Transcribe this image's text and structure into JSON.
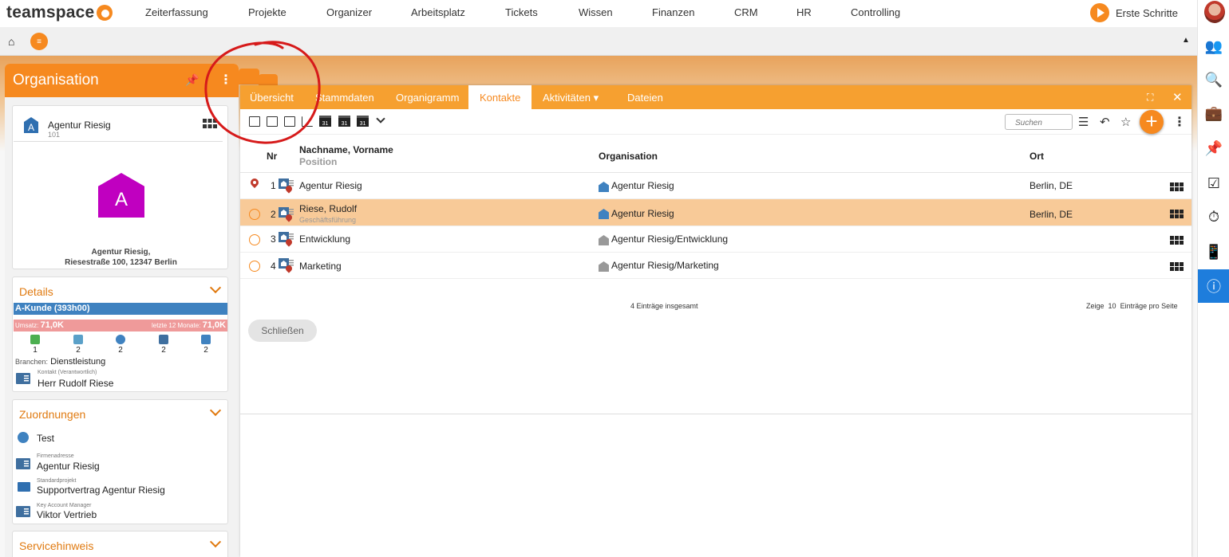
{
  "app": {
    "logo": "teamspace"
  },
  "topnav": {
    "items": [
      "Zeiterfassung",
      "Projekte",
      "Organizer",
      "Arbeitsplatz",
      "Tickets",
      "Wissen",
      "Finanzen",
      "CRM",
      "HR",
      "Controlling"
    ],
    "erste_schritte": "Erste Schritte"
  },
  "colors": {
    "accent": "#f6891f",
    "tab_bar": "#f6a030",
    "selected_row": "#f8ca98",
    "info_blue": "#1e7ddc",
    "akunde": "#3f82c0",
    "umsatz": "#ef9a9a",
    "org_magenta": "#c000c0",
    "annotation": "#d61a1a"
  },
  "left_panel": {
    "title": "Organisation",
    "org": {
      "icon_letter": "A",
      "name": "Agentur Riesig",
      "number": "101",
      "address_line1": "Agentur Riesig,",
      "address_line2": "Riesestraße 100, 12347 Berlin"
    },
    "details": {
      "title": "Details",
      "category": "A-Kunde (393h00)",
      "umsatz_label": "Umsatz:",
      "umsatz_value": "71,0K",
      "letzte_label": "letzte 12 Monate:",
      "letzte_value": "71,0K",
      "counts": [
        "1",
        "2",
        "2",
        "2",
        "2"
      ],
      "branchen_label": "Branchen:",
      "branchen_value": "Dienstleistung",
      "kontakt_label": "Kontakt (Verantwortlich)",
      "kontakt_value": "Herr Rudolf Riese"
    },
    "zuordnungen": {
      "title": "Zuordnungen",
      "items": [
        {
          "label": "",
          "value": "Test"
        },
        {
          "label": "Firmenadresse",
          "value": "Agentur Riesig"
        },
        {
          "label": "Standardprojekt",
          "value": "Supportvertrag Agentur Riesig"
        },
        {
          "label": "Key Account Manager",
          "value": "Viktor Vertrieb"
        }
      ]
    },
    "servicehinweis": {
      "title": "Servicehinweis"
    }
  },
  "main": {
    "tabs": [
      "Übersicht",
      "Stammdaten",
      "Organigramm",
      "Kontakte",
      "Aktivitäten ▾",
      "Dateien"
    ],
    "active_tab": "Kontakte",
    "search_placeholder": "Suchen",
    "columns": {
      "nr": "Nr",
      "name": "Nachname, Vorname",
      "position": "Position",
      "organisation": "Organisation",
      "ort": "Ort"
    },
    "rows": [
      {
        "nr": "1",
        "name": "Agentur Riesig",
        "position": "",
        "organisation": "Agentur Riesig",
        "ort": "Berlin, DE"
      },
      {
        "nr": "2",
        "name": "Riese, Rudolf",
        "position": "Geschäftsführung",
        "organisation": "Agentur Riesig",
        "ort": "Berlin, DE"
      },
      {
        "nr": "3",
        "name": "Entwicklung",
        "position": "",
        "organisation": "Agentur Riesig/Entwicklung",
        "ort": ""
      },
      {
        "nr": "4",
        "name": "Marketing",
        "position": "",
        "organisation": "Agentur Riesig/Marketing",
        "ort": ""
      }
    ],
    "total": "4 Einträge insgesamt",
    "paging": {
      "prefix": "Zeige",
      "value": "10",
      "suffix": "Einträge pro Seite"
    },
    "close_button": "Schließen"
  },
  "icons": {
    "rightbar": [
      "avatar",
      "users-icon",
      "search-icon",
      "briefcase-icon",
      "pin-icon",
      "tasks-icon",
      "stopwatch-icon",
      "phone-icon",
      "info-icon"
    ]
  }
}
